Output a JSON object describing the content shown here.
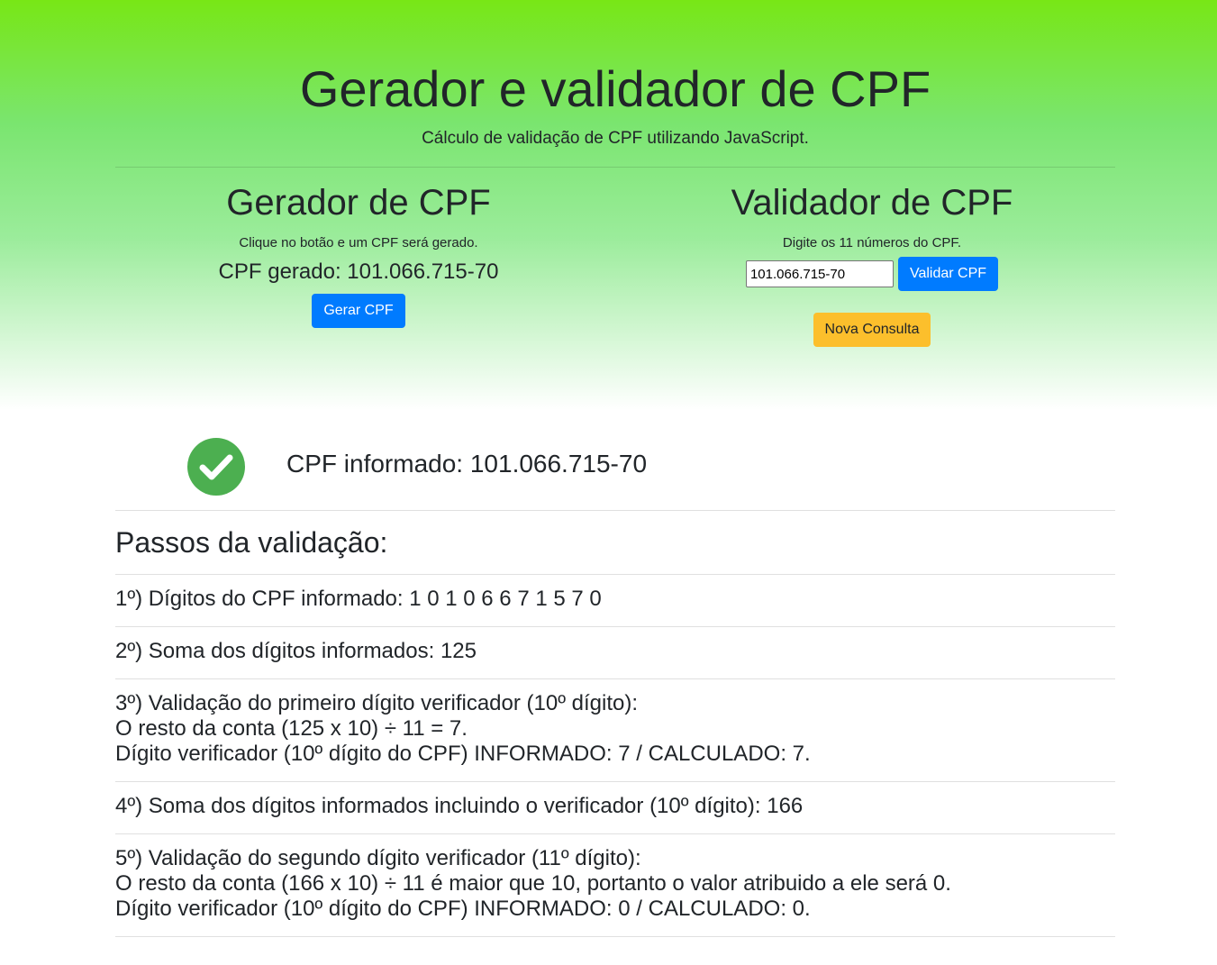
{
  "header": {
    "title": "Gerador e validador de CPF",
    "subtitle": "Cálculo de validação de CPF utilizando JavaScript."
  },
  "generator": {
    "title": "Gerador de CPF",
    "hint": "Clique no botão e um CPF será gerado.",
    "generated_label": "CPF gerado: 101.066.715-70",
    "button_label": "Gerar CPF"
  },
  "validator": {
    "title": "Validador de CPF",
    "hint": "Digite os 11 números do CPF.",
    "input_value": "101.066.715-70",
    "validate_label": "Validar CPF",
    "new_query_label": "Nova Consulta"
  },
  "result": {
    "status_icon": "check-circle-icon",
    "status_color": "#4caf50",
    "text": "CPF informado: 101.066.715-70"
  },
  "steps": {
    "title": "Passos da validação:",
    "items": [
      {
        "lines": [
          "1º) Dígitos do CPF informado: 1 0 1 0 6 6 7 1 5 7 0"
        ]
      },
      {
        "lines": [
          "2º) Soma dos dígitos informados: 125"
        ]
      },
      {
        "lines": [
          "3º) Validação do primeiro dígito verificador (10º dígito):",
          "O resto da conta (125 x 10) ÷ 11 = 7.",
          "Dígito verificador (10º dígito do CPF) INFORMADO: 7 / CALCULADO: 7."
        ]
      },
      {
        "lines": [
          "4º) Soma dos dígitos informados incluindo o verificador (10º dígito): 166"
        ]
      },
      {
        "lines": [
          "5º) Validação do segundo dígito verificador (11º dígito):",
          "O resto da conta (166 x 10) ÷ 11 é maior que 10, portanto o valor atribuido a ele será 0.",
          "Dígito verificador (10º dígito do CPF) INFORMADO: 0 / CALCULADO: 0."
        ]
      }
    ]
  },
  "colors": {
    "gradient_top": "#78e716",
    "primary": "#007bff",
    "warning": "#fcbf2c",
    "success": "#4caf50"
  }
}
